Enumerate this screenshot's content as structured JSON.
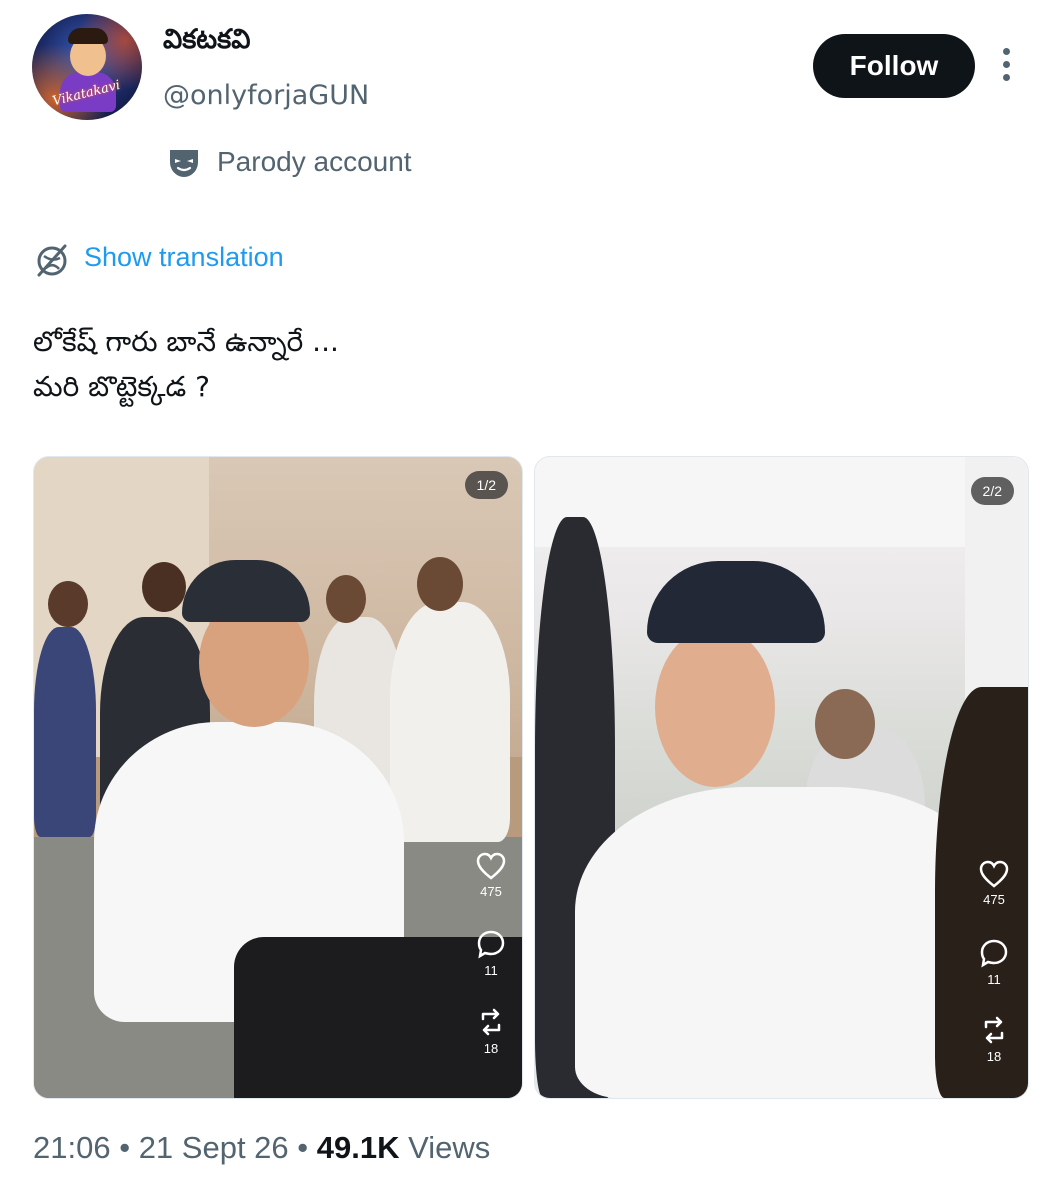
{
  "author": {
    "display_name": "వికటకవి",
    "handle": "@onlyforjaGUN",
    "avatar_text": "Vikatakavi",
    "badge": "Parody account"
  },
  "actions": {
    "follow": "Follow",
    "show_translation": "Show translation"
  },
  "tweet": {
    "lines": [
      "లోకేష్ గారు బానే ఉన్నారే ...",
      "మరి బొట్టెక్కడ ?"
    ]
  },
  "media": [
    {
      "page": "1/2",
      "likes": "475",
      "replies": "11",
      "reposts": "18"
    },
    {
      "page": "2/2",
      "likes": "475",
      "replies": "11",
      "reposts": "18"
    }
  ],
  "meta": {
    "time": "21:06",
    "date": "21 Sept 26",
    "views_count": "49.1K",
    "views_label": "Views",
    "separator": "•"
  },
  "colors": {
    "link": "#1d9bf0",
    "muted": "#536471",
    "button": "#0f1419"
  }
}
